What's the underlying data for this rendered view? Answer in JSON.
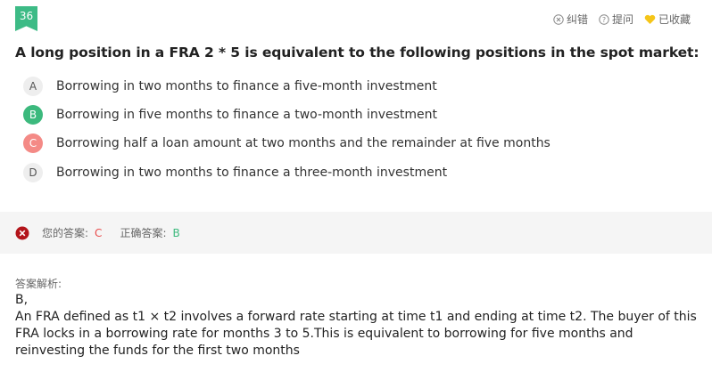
{
  "question": {
    "number": "36",
    "text": "A long position in a FRA 2 * 5 is equivalent to the following positions in the spot market:"
  },
  "toolbar": {
    "report_label": "纠错",
    "ask_label": "提问",
    "favorite_label": "已收藏"
  },
  "options": [
    {
      "letter": "A",
      "text": "Borrowing in two months to finance a five-month investment",
      "state": "default"
    },
    {
      "letter": "B",
      "text": "Borrowing in five months to finance a two-month investment",
      "state": "correct"
    },
    {
      "letter": "C",
      "text": "Borrowing half a loan amount at two months and the remainder at five months",
      "state": "wrong"
    },
    {
      "letter": "D",
      "text": "Borrowing in two months to finance a three-month investment",
      "state": "default"
    }
  ],
  "result": {
    "your_answer_label": "您的答案:",
    "your_answer": "C",
    "correct_answer_label": "正确答案:",
    "correct_answer": "B"
  },
  "analysis": {
    "label": "答案解析:",
    "answer_line": "B,",
    "explanation": "An FRA defined as t1 × t2 involves a forward rate starting at time t1 and ending at time t2. The buyer of this FRA locks in a borrowing rate for months 3 to 5.This is equivalent to borrowing for five months and reinvesting the funds for the first two months"
  },
  "colors": {
    "accent": "#3dbb86",
    "correct": "#3cb97d",
    "wrong": "#f48a86",
    "favorite": "#f5c518"
  },
  "icons": [
    "close-circle-icon",
    "question-circle-icon",
    "heart-icon",
    "error-x-icon"
  ]
}
